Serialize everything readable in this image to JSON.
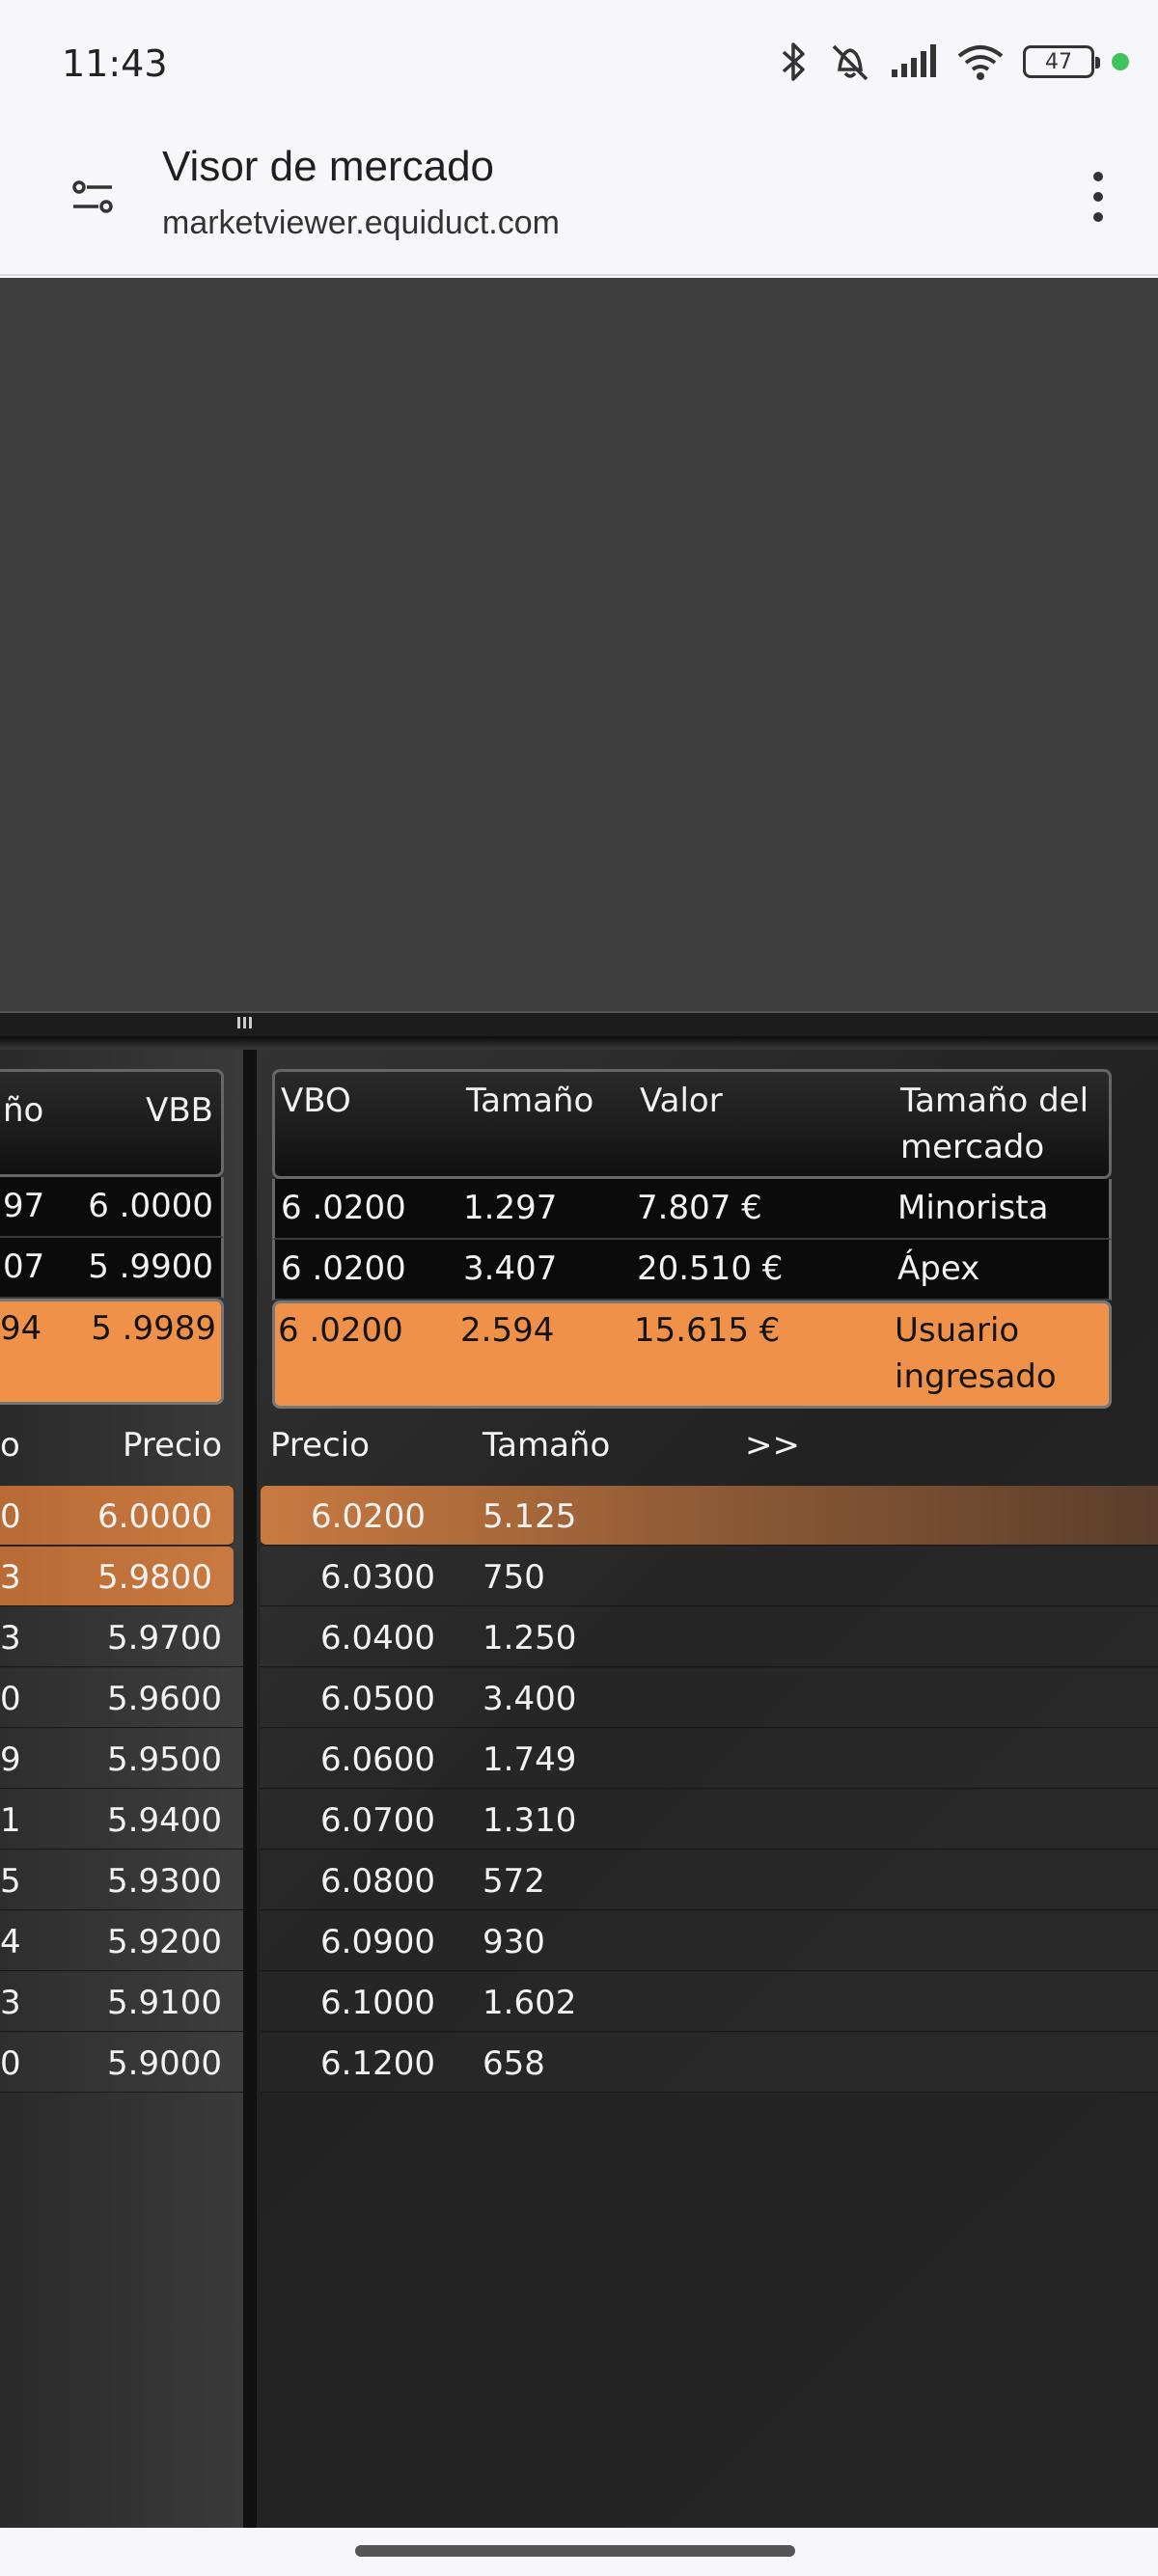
{
  "status": {
    "time": "11:43",
    "battery": "47"
  },
  "browser": {
    "title": "Visor de mercado",
    "url": "marketviewer.equiduct.com"
  },
  "left_quotes": {
    "headers": {
      "size_partial": "ño",
      "vbb": "VBB"
    },
    "rows": [
      {
        "size": "97",
        "vbb": "6 .0000"
      },
      {
        "size": "07",
        "vbb": "5 .9900"
      },
      {
        "size": "94",
        "vbb": "5 .9989"
      }
    ]
  },
  "right_quotes": {
    "headers": {
      "vbo": "VBO",
      "size": "Tamaño",
      "value": "Valor",
      "market_size_1": "Tamaño del",
      "market_size_2": "mercado"
    },
    "rows": [
      {
        "vbo": "6 .0200",
        "size": "1.297",
        "value": "7.807 €",
        "market": "Minorista"
      },
      {
        "vbo": "6 .0200",
        "size": "3.407",
        "value": "20.510 €",
        "market": "Ápex"
      },
      {
        "vbo": "6 .0200",
        "size": "2.594",
        "value": "15.615 €",
        "market_1": "Usuario",
        "market_2": "ingresado"
      }
    ]
  },
  "left_book": {
    "headers": {
      "size_partial": "o",
      "price": "Precio"
    },
    "rows": [
      {
        "size": "0",
        "price": "6.0000"
      },
      {
        "size": "3",
        "price": "5.9800"
      },
      {
        "size": "3",
        "price": "5.9700"
      },
      {
        "size": "0",
        "price": "5.9600"
      },
      {
        "size": "9",
        "price": "5.9500"
      },
      {
        "size": "1",
        "price": "5.9400"
      },
      {
        "size": "5",
        "price": "5.9300"
      },
      {
        "size": "4",
        "price": "5.9200"
      },
      {
        "size": "3",
        "price": "5.9100"
      },
      {
        "size": "0",
        "price": "5.9000"
      }
    ]
  },
  "right_book": {
    "headers": {
      "price": "Precio",
      "size": "Tamaño",
      "more": ">>"
    },
    "rows": [
      {
        "price": "6.0200",
        "size": "5.125"
      },
      {
        "price": "6.0300",
        "size": "750"
      },
      {
        "price": "6.0400",
        "size": "1.250"
      },
      {
        "price": "6.0500",
        "size": "3.400"
      },
      {
        "price": "6.0600",
        "size": "1.749"
      },
      {
        "price": "6.0700",
        "size": "1.310"
      },
      {
        "price": "6.0800",
        "size": "572"
      },
      {
        "price": "6.0900",
        "size": "930"
      },
      {
        "price": "6.1000",
        "size": "1.602"
      },
      {
        "price": "6.1200",
        "size": "658"
      }
    ]
  },
  "colors": {
    "highlight": "#f0914a",
    "background": "#242424"
  }
}
